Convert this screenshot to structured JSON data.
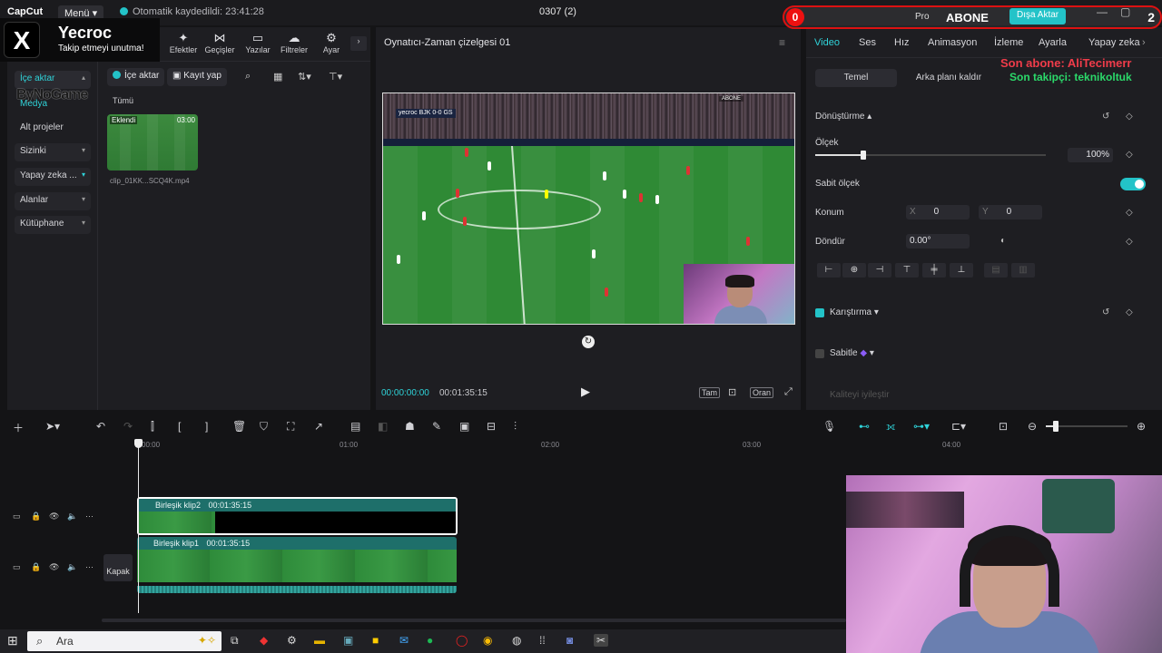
{
  "titlebar": {
    "app_name": "CapCut",
    "menu_label": "Menü",
    "autosave": "Otomatik kaydedildi: 23:41:28",
    "project_title": "0307 (2)"
  },
  "left_toolbar": {
    "tools": [
      "Efektler",
      "Geçişler",
      "Yazılar",
      "Filtreler",
      "Ayar"
    ]
  },
  "left_nav": {
    "items": [
      {
        "label": "İçe aktar",
        "active": true
      },
      {
        "label": "Medya",
        "sub": true
      },
      {
        "label": "Alt projeler",
        "sub": true
      },
      {
        "label": "Sizinki"
      },
      {
        "label": "Yapay zeka ..."
      },
      {
        "label": "Alanlar"
      },
      {
        "label": "Kütüphane"
      }
    ]
  },
  "media": {
    "import_button": "İçe aktar",
    "record_button": "Kayıt yap",
    "all_label": "Tümü",
    "clip_badge": "Eklendi",
    "clip_duration": "03:00",
    "clip_name": "clip_01KK...SCQ4K.mp4"
  },
  "player": {
    "title": "Oynatıcı-Zaman çizelgesi 01",
    "current_time": "00:00:00:00",
    "total_time": "00:01:35:15",
    "full_label": "Tam",
    "ratio_label": "Oran",
    "overlay_channel": "yecroc",
    "overlay_score_home": "0",
    "overlay_score_away": "0",
    "overlay_team_home": "BJK",
    "overlay_team_away": "GS",
    "overlay_abone": "ABONE"
  },
  "right_panel": {
    "tabs": [
      "Video",
      "Ses",
      "Hız",
      "Animasyon",
      "İzleme",
      "Ayarla",
      "Yapay zeka"
    ],
    "segments": [
      "Temel",
      "Arka planı kaldır"
    ],
    "transform_title": "Dönüştürme",
    "scale_label": "Ölçek",
    "scale_value": "100%",
    "uniform_scale_label": "Sabit ölçek",
    "position_label": "Konum",
    "x_label": "X",
    "x_value": "0",
    "y_label": "Y",
    "y_value": "0",
    "rotate_label": "Döndür",
    "rotate_value": "0.00°",
    "blend_label": "Karıştırma",
    "stabilize_label": "Sabitle",
    "enhance_label": "Kaliteyi iyileştir"
  },
  "timeline": {
    "ticks": [
      "00:00",
      "01:00",
      "02:00",
      "03:00",
      "04:00"
    ],
    "clips": [
      {
        "name": "Birleşik klip2",
        "duration": "00:01:35:15"
      },
      {
        "name": "Birleşik klip1",
        "duration": "00:01:35:15"
      }
    ],
    "cover_label": "Kapak"
  },
  "overlays": {
    "x_name": "Yecroc",
    "x_sub": "Takip etmeyi unutma!",
    "sponsor": "ByNoGame",
    "abone_count": "0",
    "abone_label": "ABONE",
    "abone_number": "2",
    "pro_label": "Pro",
    "export_label": "Dışa Aktar",
    "last_sub": "Son abone: AliTecimerr",
    "last_follow": "Son takipçi: teknikoltuk"
  },
  "taskbar": {
    "search_placeholder": "Ara"
  },
  "colors": {
    "accent": "#23c3c8",
    "accent_text": "#2fd3d9",
    "alert_red": "#e11111",
    "follow_green": "#2bd96a"
  }
}
